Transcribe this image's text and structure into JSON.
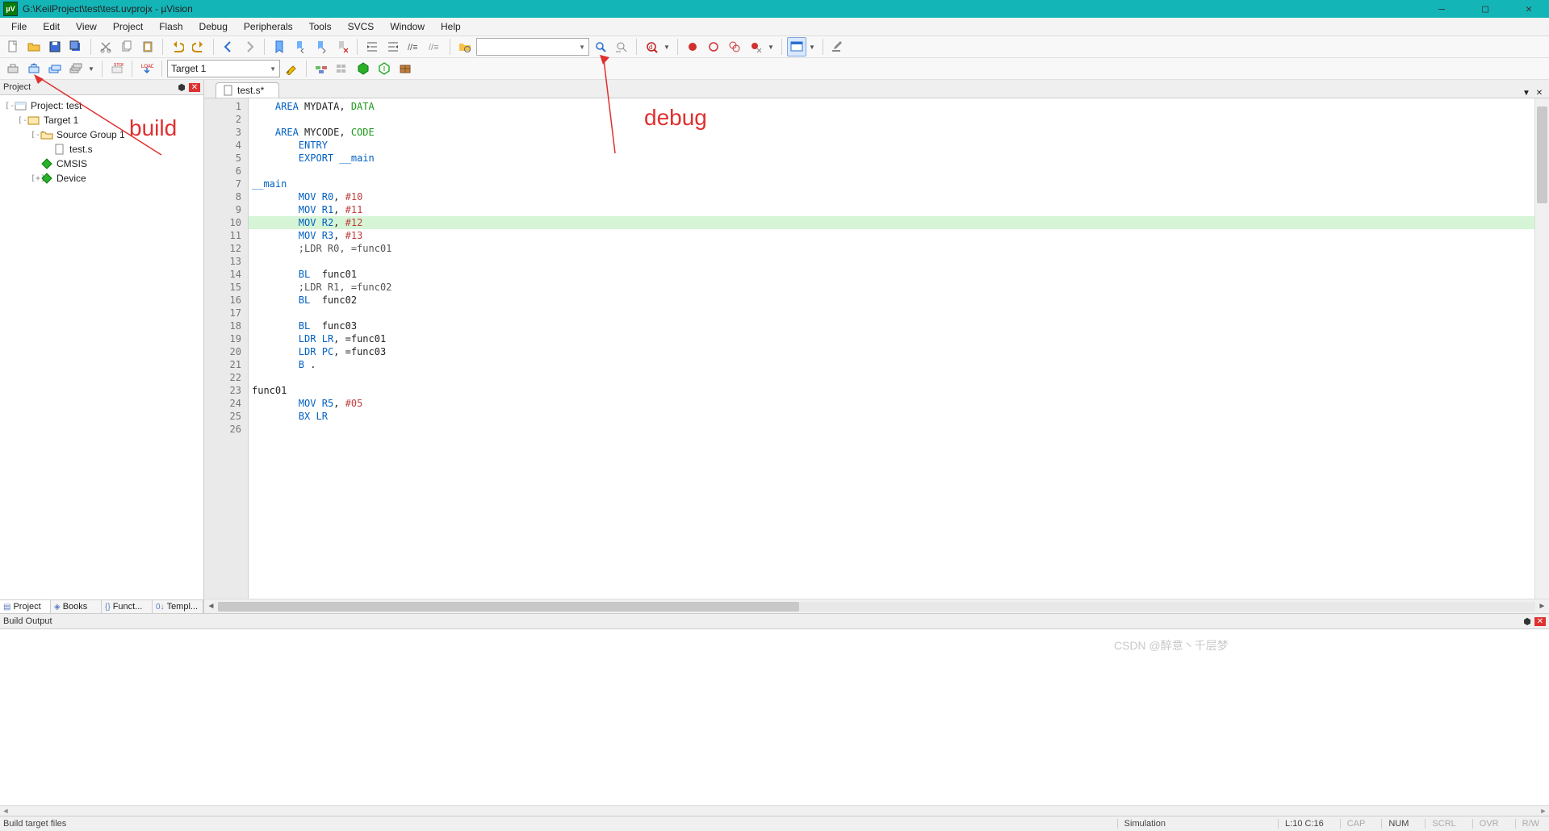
{
  "window": {
    "title": "G:\\KeilProject\\test\\test.uvprojx - µVision",
    "appicon_label": "µV"
  },
  "menubar": [
    "File",
    "Edit",
    "View",
    "Project",
    "Flash",
    "Debug",
    "Peripherals",
    "Tools",
    "SVCS",
    "Window",
    "Help"
  ],
  "toolbar1": {
    "search_placeholder": ""
  },
  "toolbar2": {
    "target_label": "Target 1"
  },
  "project_pane": {
    "title": "Project",
    "tree": [
      {
        "level": 0,
        "expand": "-",
        "icon": "project",
        "label": "Project: test"
      },
      {
        "level": 1,
        "expand": "-",
        "icon": "target",
        "label": "Target 1"
      },
      {
        "level": 2,
        "expand": "-",
        "icon": "folder",
        "label": "Source Group 1"
      },
      {
        "level": 3,
        "expand": "",
        "icon": "file",
        "label": "test.s"
      },
      {
        "level": 2,
        "expand": "",
        "icon": "diamond",
        "label": "CMSIS"
      },
      {
        "level": 2,
        "expand": "+",
        "icon": "diamond",
        "label": "Device"
      }
    ],
    "tabs": [
      {
        "id": "project",
        "label": "Project",
        "active": true
      },
      {
        "id": "books",
        "label": "Books"
      },
      {
        "id": "funcs",
        "label": "Funct..."
      },
      {
        "id": "templ",
        "label": "Templ..."
      }
    ]
  },
  "editor": {
    "tab_label": "test.s*",
    "highlight_line": 10,
    "lines": [
      {
        "n": 1,
        "tokens": [
          {
            "c": "kw1",
            "t": "    AREA"
          },
          {
            "t": " MYDATA, "
          },
          {
            "c": "kw2",
            "t": "DATA"
          }
        ]
      },
      {
        "n": 2,
        "tokens": []
      },
      {
        "n": 3,
        "tokens": [
          {
            "c": "kw1",
            "t": "    AREA"
          },
          {
            "t": " MYCODE, "
          },
          {
            "c": "kw2",
            "t": "CODE"
          }
        ]
      },
      {
        "n": 4,
        "tokens": [
          {
            "c": "kw1",
            "t": "        ENTRY"
          }
        ]
      },
      {
        "n": 5,
        "tokens": [
          {
            "c": "kw1",
            "t": "        EXPORT"
          },
          {
            "t": " "
          },
          {
            "c": "lbl",
            "t": "__main"
          }
        ]
      },
      {
        "n": 6,
        "tokens": []
      },
      {
        "n": 7,
        "tokens": [
          {
            "c": "lbl",
            "t": "__main"
          }
        ]
      },
      {
        "n": 8,
        "tokens": [
          {
            "t": "        "
          },
          {
            "c": "kw1",
            "t": "MOV"
          },
          {
            "t": " "
          },
          {
            "c": "reg",
            "t": "R0"
          },
          {
            "t": ", "
          },
          {
            "c": "num",
            "t": "#10"
          }
        ]
      },
      {
        "n": 9,
        "tokens": [
          {
            "t": "        "
          },
          {
            "c": "kw1",
            "t": "MOV"
          },
          {
            "t": " "
          },
          {
            "c": "reg",
            "t": "R1"
          },
          {
            "t": ", "
          },
          {
            "c": "num",
            "t": "#11"
          }
        ]
      },
      {
        "n": 10,
        "tokens": [
          {
            "t": "        "
          },
          {
            "c": "kw1",
            "t": "MOV"
          },
          {
            "t": " "
          },
          {
            "c": "reg",
            "t": "R2"
          },
          {
            "t": ", "
          },
          {
            "c": "num",
            "t": "#12"
          }
        ]
      },
      {
        "n": 11,
        "tokens": [
          {
            "t": "        "
          },
          {
            "c": "kw1",
            "t": "MOV"
          },
          {
            "t": " "
          },
          {
            "c": "reg",
            "t": "R3"
          },
          {
            "t": ", "
          },
          {
            "c": "num",
            "t": "#13"
          }
        ]
      },
      {
        "n": 12,
        "tokens": [
          {
            "t": "        "
          },
          {
            "c": "cmnt",
            "t": ";LDR R0, =func01"
          }
        ]
      },
      {
        "n": 13,
        "tokens": []
      },
      {
        "n": 14,
        "tokens": [
          {
            "t": "        "
          },
          {
            "c": "kw1",
            "t": "BL"
          },
          {
            "t": "  func01"
          }
        ]
      },
      {
        "n": 15,
        "tokens": [
          {
            "t": "        "
          },
          {
            "c": "cmnt",
            "t": ";LDR R1, =func02"
          }
        ]
      },
      {
        "n": 16,
        "tokens": [
          {
            "t": "        "
          },
          {
            "c": "kw1",
            "t": "BL"
          },
          {
            "t": "  func02"
          }
        ]
      },
      {
        "n": 17,
        "tokens": []
      },
      {
        "n": 18,
        "tokens": [
          {
            "t": "        "
          },
          {
            "c": "kw1",
            "t": "BL"
          },
          {
            "t": "  func03"
          }
        ]
      },
      {
        "n": 19,
        "tokens": [
          {
            "t": "        "
          },
          {
            "c": "kw1",
            "t": "LDR"
          },
          {
            "t": " "
          },
          {
            "c": "reg",
            "t": "LR"
          },
          {
            "t": ", =func01"
          }
        ]
      },
      {
        "n": 20,
        "tokens": [
          {
            "t": "        "
          },
          {
            "c": "kw1",
            "t": "LDR"
          },
          {
            "t": " "
          },
          {
            "c": "reg",
            "t": "PC"
          },
          {
            "t": ", =func03"
          }
        ]
      },
      {
        "n": 21,
        "tokens": [
          {
            "t": "        "
          },
          {
            "c": "kw1",
            "t": "B"
          },
          {
            "t": " ."
          }
        ]
      },
      {
        "n": 22,
        "tokens": []
      },
      {
        "n": 23,
        "tokens": [
          {
            "t": "func01"
          }
        ]
      },
      {
        "n": 24,
        "tokens": [
          {
            "t": "        "
          },
          {
            "c": "kw1",
            "t": "MOV"
          },
          {
            "t": " "
          },
          {
            "c": "reg",
            "t": "R5"
          },
          {
            "t": ", "
          },
          {
            "c": "num",
            "t": "#05"
          }
        ]
      },
      {
        "n": 25,
        "tokens": [
          {
            "t": "        "
          },
          {
            "c": "kw1",
            "t": "BX"
          },
          {
            "t": " "
          },
          {
            "c": "reg",
            "t": "LR"
          }
        ]
      },
      {
        "n": 26,
        "tokens": []
      }
    ]
  },
  "build_output": {
    "title": "Build Output"
  },
  "statusbar": {
    "left": "Build target files",
    "sim": "Simulation",
    "pos": "L:10 C:16",
    "cap": "CAP",
    "num": "NUM",
    "scrl": "SCRL",
    "ovr": "OVR",
    "rw": "R/W"
  },
  "annotations": {
    "build": "build",
    "debug": "debug"
  },
  "watermark": "CSDN @醉意丶千层梦"
}
